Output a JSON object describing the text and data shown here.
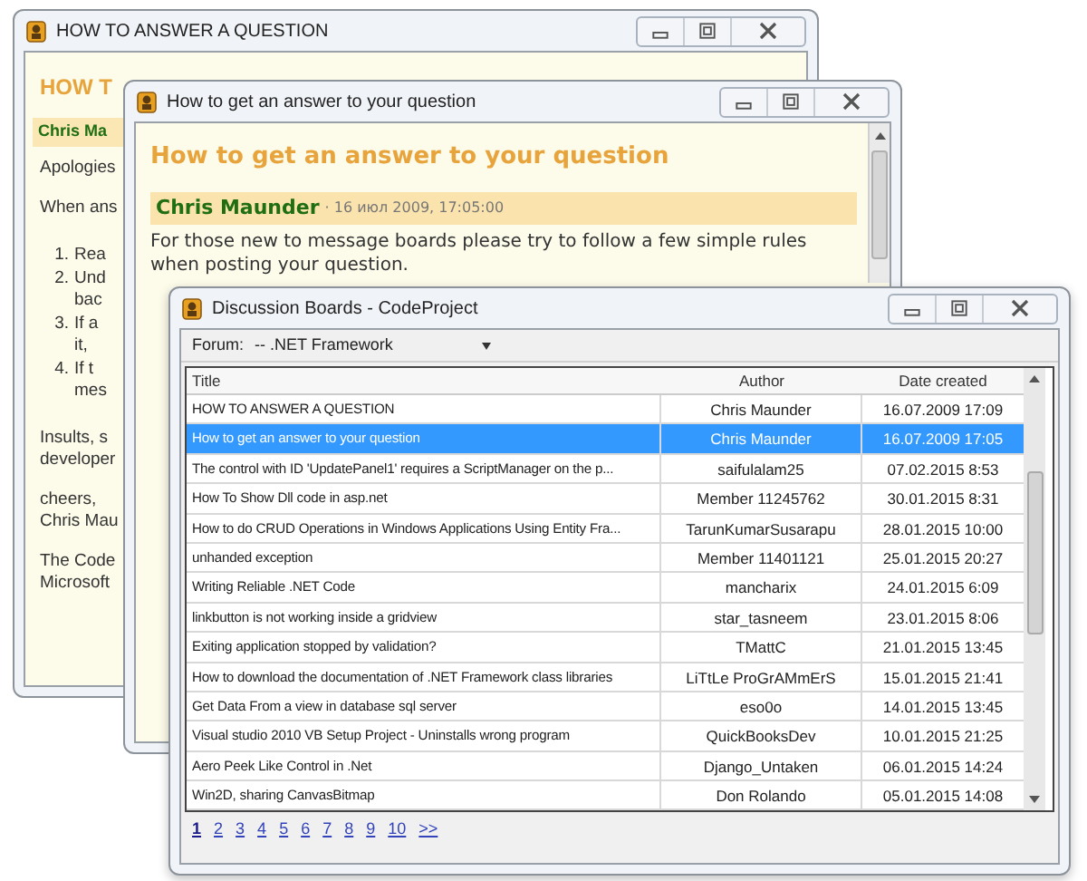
{
  "back_window": {
    "title": "HOW TO ANSWER A QUESTION",
    "heading": "HOW T",
    "author": "Chris Ma",
    "blocks": [
      {
        "kind": "para",
        "lines": [
          "Apologies"
        ]
      },
      {
        "kind": "para",
        "lines": [
          "When ans"
        ]
      },
      {
        "kind": "list",
        "items": [
          {
            "number": "1.",
            "lines": [
              "Rea"
            ]
          },
          {
            "number": "2.",
            "lines": [
              "Und",
              "bac"
            ]
          },
          {
            "number": "3.",
            "lines": [
              "If a",
              "it,"
            ]
          },
          {
            "number": "4.",
            "lines": [
              "If t",
              "mes"
            ]
          }
        ]
      },
      {
        "kind": "para",
        "lines": [
          "Insults, s",
          "developer"
        ]
      },
      {
        "kind": "para",
        "lines": [
          "cheers,",
          "Chris Mau"
        ]
      },
      {
        "kind": "para",
        "lines": [
          "The Code",
          "Microsoft"
        ]
      }
    ]
  },
  "question_window": {
    "title": "How to get an answer to your question",
    "heading": "How to get an answer to your question",
    "author": "Chris Maunder",
    "date": "· 16 июл 2009, 17:05:00",
    "body": "For those new to message boards please try to follow a few simple rules when posting your question."
  },
  "boards_window": {
    "title": "Discussion Boards - CodeProject",
    "forum_label": "Forum:",
    "forum_value": "-- .NET Framework",
    "columns": [
      "Title",
      "Author",
      "Date created"
    ],
    "rows": [
      {
        "title": "HOW TO ANSWER A QUESTION",
        "author": "Chris Maunder",
        "date": "16.07.2009 17:09",
        "selected": false
      },
      {
        "title": "How to get an answer to your question",
        "author": "Chris Maunder",
        "date": "16.07.2009 17:05",
        "selected": true
      },
      {
        "title": "The control with ID 'UpdatePanel1' requires a ScriptManager on the p...",
        "author": "saifulalam25",
        "date": "07.02.2015 8:53",
        "selected": false
      },
      {
        "title": "How To Show Dll code in asp.net",
        "author": "Member 11245762",
        "date": "30.01.2015 8:31",
        "selected": false
      },
      {
        "title": "How to do CRUD Operations in Windows Applications Using Entity Fra...",
        "author": "TarunKumarSusarapu",
        "date": "28.01.2015 10:00",
        "selected": false
      },
      {
        "title": "unhanded exception",
        "author": "Member 11401121",
        "date": "25.01.2015 20:27",
        "selected": false
      },
      {
        "title": "Writing Reliable .NET Code",
        "author": "mancharix",
        "date": "24.01.2015 6:09",
        "selected": false
      },
      {
        "title": "linkbutton is not working inside a gridview",
        "author": "star_tasneem",
        "date": "23.01.2015 8:06",
        "selected": false
      },
      {
        "title": "Exiting application stopped by validation?",
        "author": "TMattC",
        "date": "21.01.2015 13:45",
        "selected": false
      },
      {
        "title": "How to download the documentation of .NET Framework class libraries",
        "author": "LiTtLe ProGrAMmErS",
        "date": "15.01.2015 21:41",
        "selected": false
      },
      {
        "title": "Get Data From a view in database sql server",
        "author": "eso0o",
        "date": "14.01.2015 13:45",
        "selected": false
      },
      {
        "title": "Visual studio 2010 VB Setup Project - Uninstalls wrong program",
        "author": "QuickBooksDev",
        "date": "10.01.2015 21:25",
        "selected": false
      },
      {
        "title": "Aero Peek Like Control in .Net",
        "author": "Django_Untaken",
        "date": "06.01.2015 14:24",
        "selected": false
      },
      {
        "title": "Win2D, sharing CanvasBitmap",
        "author": "Don Rolando",
        "date": "05.01.2015 14:08",
        "selected": false
      }
    ],
    "pages": [
      {
        "label": "1",
        "selected": true
      },
      {
        "label": "2",
        "selected": false
      },
      {
        "label": "3",
        "selected": false
      },
      {
        "label": "4",
        "selected": false
      },
      {
        "label": "5",
        "selected": false
      },
      {
        "label": "6",
        "selected": false
      },
      {
        "label": "7",
        "selected": false
      },
      {
        "label": "8",
        "selected": false
      },
      {
        "label": "9",
        "selected": false
      },
      {
        "label": "10",
        "selected": false
      },
      {
        "label": ">>",
        "selected": false
      }
    ]
  }
}
